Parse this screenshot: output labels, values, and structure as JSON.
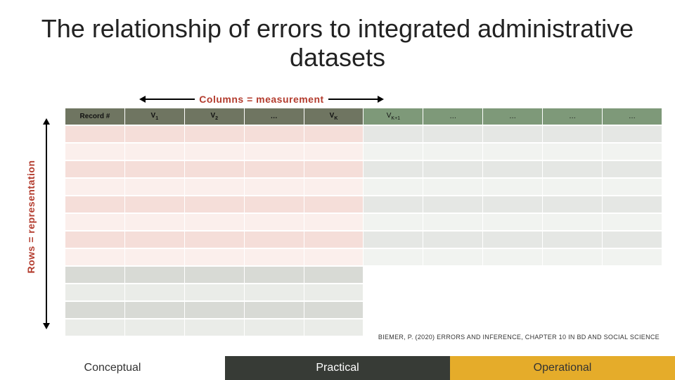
{
  "title": "The relationship of errors to integrated administrative datasets",
  "columns_label": "Columns = measurement",
  "rows_label": "Rows = representation",
  "headers": {
    "record": "Record #",
    "v1": "V",
    "v1s": "1",
    "v2": "V",
    "v2s": "2",
    "dots": "…",
    "vk": "V",
    "vks": "K",
    "vk1": "V",
    "vk1s": "K+1",
    "h7": "…",
    "h8": "…",
    "h9": "…",
    "h10": "…"
  },
  "citation": "BIEMER, P. (2020) ERRORS AND INFERENCE, CHAPTER 10 IN BD AND SOCIAL SCIENCE",
  "footer": {
    "c": "Conceptual",
    "p": "Practical",
    "o": "Operational"
  }
}
